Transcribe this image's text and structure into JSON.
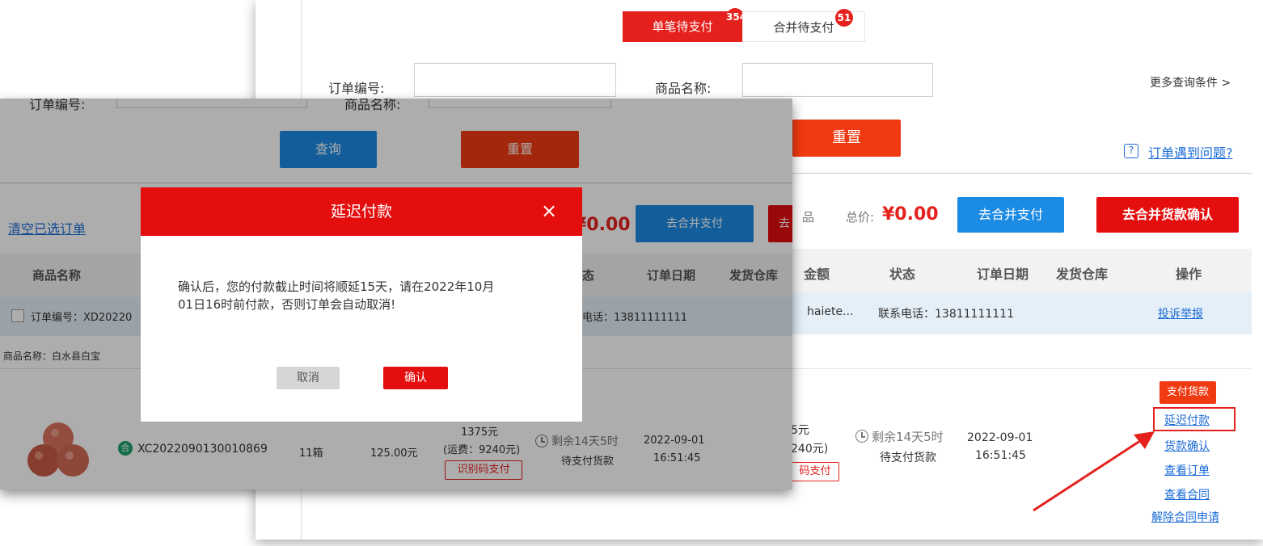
{
  "back": {
    "tabs": [
      {
        "label": "单笔待支付",
        "badge": "354",
        "active": true
      },
      {
        "label": "合并待支付",
        "badge": "51",
        "active": false
      }
    ],
    "search": {
      "order_no_label": "订单编号:",
      "product_name_label": "商品名称:",
      "more_conditions": "更多查询条件 >",
      "reset_label": "重置",
      "help_link": "订单遇到问题?"
    },
    "summary": {
      "product_text": "品",
      "total_label": "总价:",
      "total_value": "¥0.00",
      "merge_pay_label": "去合并支付",
      "merge_confirm_label": "去合并货款确认"
    },
    "table_headers": [
      "金额",
      "状态",
      "订单日期",
      "发货仓库",
      "操作"
    ],
    "order_row": {
      "seller": "haiete...",
      "phone": "联系电话：13811111111",
      "complaint_link": "投诉举报"
    },
    "detail": {
      "amount_line1": "5元",
      "amount_line2": "240元)",
      "pay_tag": "码支付",
      "countdown": "剩余14天5时",
      "status": "待支付货款",
      "date": "2022-09-01",
      "time": "16:51:45"
    },
    "actions": {
      "pay": "支付货款",
      "delay": "延迟付款",
      "confirm": "货款确认",
      "view_order": "查看订单",
      "view_contract": "查看合同",
      "cancel_contract": "解除合同申请"
    },
    "colors": {
      "accent_red": "#e5211d",
      "accent_blue": "#1c8be4",
      "link_blue": "#1a6ad6"
    }
  },
  "front": {
    "top_labels": {
      "order_no": "订单编号:",
      "product_name": "商品名称:"
    },
    "query_label": "查询",
    "reset_label": "重置",
    "clear_selected": "清空已选订单",
    "total_partial": "¥0.00",
    "merge_pay_label": "去合并支付",
    "partial_button": "去",
    "headers": [
      "商品名称",
      "态",
      "订单日期",
      "发货仓库"
    ],
    "order_row": {
      "order_no": "订单编号：XD20220",
      "phone": "电话：13811111111"
    },
    "product_name_row": "商品名称：白水县白宝",
    "item": {
      "order_code": "XC2022090130010869",
      "quantity": "11箱",
      "unit_price": "125.00元",
      "total": "1375元",
      "freight": "(运费：9240元)",
      "pay_tag": "识别码支付",
      "countdown": "剩余14天5时",
      "status": "待支付货款",
      "date": "2022-09-01",
      "time": "16:51:45"
    }
  },
  "modal": {
    "title": "延迟付款",
    "close": "×",
    "message_line1": "确认后，您的付款截止时间将顺延15天，请在2022年10月",
    "message_line2": "01日16时前付款，否则订单会自动取消!",
    "cancel_label": "取消",
    "confirm_label": "确认"
  }
}
